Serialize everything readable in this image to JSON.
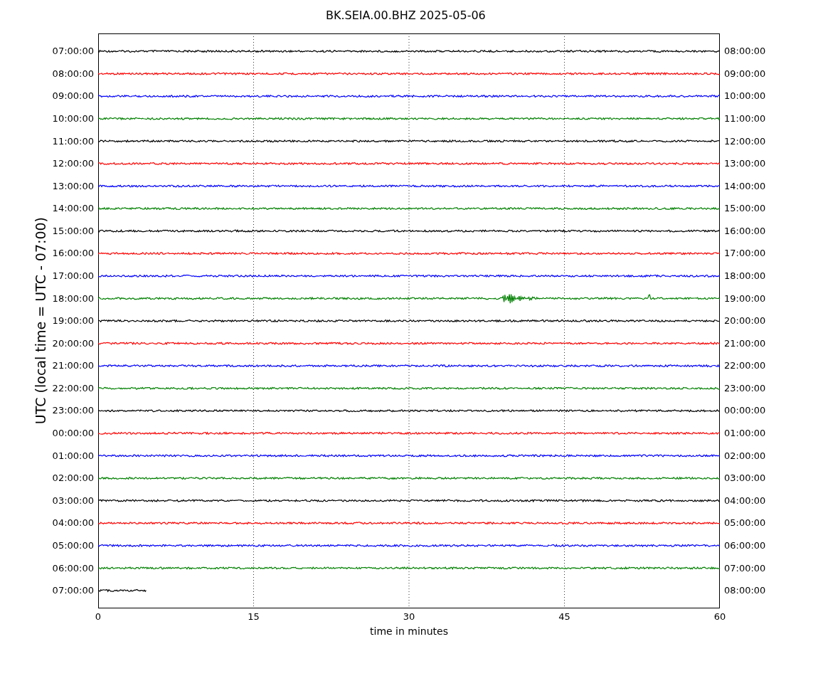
{
  "title": "BK.SEIA.00.BHZ 2025-05-06",
  "ylabel": "UTC (local time = UTC - 07:00)",
  "xlabel": "time in minutes",
  "xticks": [
    "0",
    "15",
    "30",
    "45",
    "60"
  ],
  "rows": [
    {
      "left": "07:00:00",
      "right": "08:00:00",
      "color": "#000000",
      "kind": "full"
    },
    {
      "left": "08:00:00",
      "right": "09:00:00",
      "color": "#ff0000",
      "kind": "full"
    },
    {
      "left": "09:00:00",
      "right": "10:00:00",
      "color": "#0000ff",
      "kind": "full"
    },
    {
      "left": "10:00:00",
      "right": "11:00:00",
      "color": "#008000",
      "kind": "full"
    },
    {
      "left": "11:00:00",
      "right": "12:00:00",
      "color": "#000000",
      "kind": "full"
    },
    {
      "left": "12:00:00",
      "right": "13:00:00",
      "color": "#ff0000",
      "kind": "full"
    },
    {
      "left": "13:00:00",
      "right": "14:00:00",
      "color": "#0000ff",
      "kind": "full"
    },
    {
      "left": "14:00:00",
      "right": "15:00:00",
      "color": "#008000",
      "kind": "full"
    },
    {
      "left": "15:00:00",
      "right": "16:00:00",
      "color": "#000000",
      "kind": "full"
    },
    {
      "left": "16:00:00",
      "right": "17:00:00",
      "color": "#ff0000",
      "kind": "full"
    },
    {
      "left": "17:00:00",
      "right": "18:00:00",
      "color": "#0000ff",
      "kind": "full"
    },
    {
      "left": "18:00:00",
      "right": "19:00:00",
      "color": "#008000",
      "kind": "event"
    },
    {
      "left": "19:00:00",
      "right": "20:00:00",
      "color": "#000000",
      "kind": "full"
    },
    {
      "left": "20:00:00",
      "right": "21:00:00",
      "color": "#ff0000",
      "kind": "full"
    },
    {
      "left": "21:00:00",
      "right": "22:00:00",
      "color": "#0000ff",
      "kind": "full"
    },
    {
      "left": "22:00:00",
      "right": "23:00:00",
      "color": "#008000",
      "kind": "full"
    },
    {
      "left": "23:00:00",
      "right": "00:00:00",
      "color": "#000000",
      "kind": "full"
    },
    {
      "left": "00:00:00",
      "right": "01:00:00",
      "color": "#ff0000",
      "kind": "full"
    },
    {
      "left": "01:00:00",
      "right": "02:00:00",
      "color": "#0000ff",
      "kind": "full"
    },
    {
      "left": "02:00:00",
      "right": "03:00:00",
      "color": "#008000",
      "kind": "full"
    },
    {
      "left": "03:00:00",
      "right": "04:00:00",
      "color": "#000000",
      "kind": "full"
    },
    {
      "left": "04:00:00",
      "right": "05:00:00",
      "color": "#ff0000",
      "kind": "full"
    },
    {
      "left": "05:00:00",
      "right": "06:00:00",
      "color": "#0000ff",
      "kind": "full"
    },
    {
      "left": "06:00:00",
      "right": "07:00:00",
      "color": "#008000",
      "kind": "full"
    },
    {
      "left": "07:00:00",
      "right": "08:00:00",
      "color": "#000000",
      "kind": "partial"
    }
  ]
}
